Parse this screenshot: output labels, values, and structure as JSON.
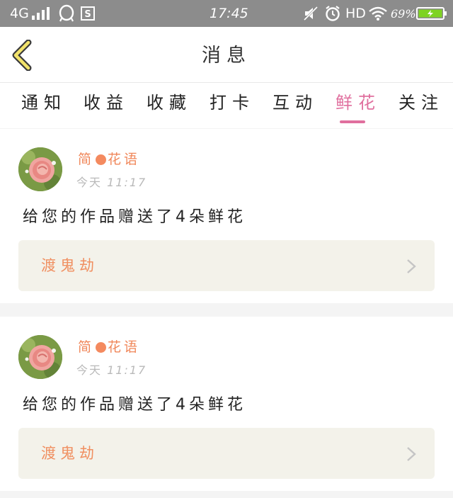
{
  "status_bar": {
    "network": "4G",
    "time": "17:45",
    "hd": "HD",
    "battery": "69%",
    "icons": [
      "signal-icon",
      "qq-icon",
      "s-app-icon",
      "mute-icon",
      "alarm-icon",
      "wifi-icon",
      "battery-icon"
    ]
  },
  "header": {
    "title": "消息",
    "back_icon": "chevron-left-icon"
  },
  "tabs": [
    {
      "label": "通知",
      "active": false
    },
    {
      "label": "收益",
      "active": false
    },
    {
      "label": "收藏",
      "active": false
    },
    {
      "label": "打卡",
      "active": false
    },
    {
      "label": "互动",
      "active": false
    },
    {
      "label": "鲜花",
      "active": true
    },
    {
      "label": "关注",
      "active": false
    }
  ],
  "messages": [
    {
      "user_first": "简",
      "user_rest": "花语",
      "day": "今天",
      "time": "11:17",
      "text": "给您的作品赠送了4朵鲜花",
      "work_title": "渡鬼劫"
    },
    {
      "user_first": "简",
      "user_rest": "花语",
      "day": "今天",
      "time": "11:17",
      "text": "给您的作品赠送了4朵鲜花",
      "work_title": "渡鬼劫"
    }
  ],
  "colors": {
    "accent_pink": "#e06f9e",
    "username_orange": "#f0875a",
    "status_bar": "#8c8c8c",
    "work_box_bg": "#f3f2ea"
  }
}
